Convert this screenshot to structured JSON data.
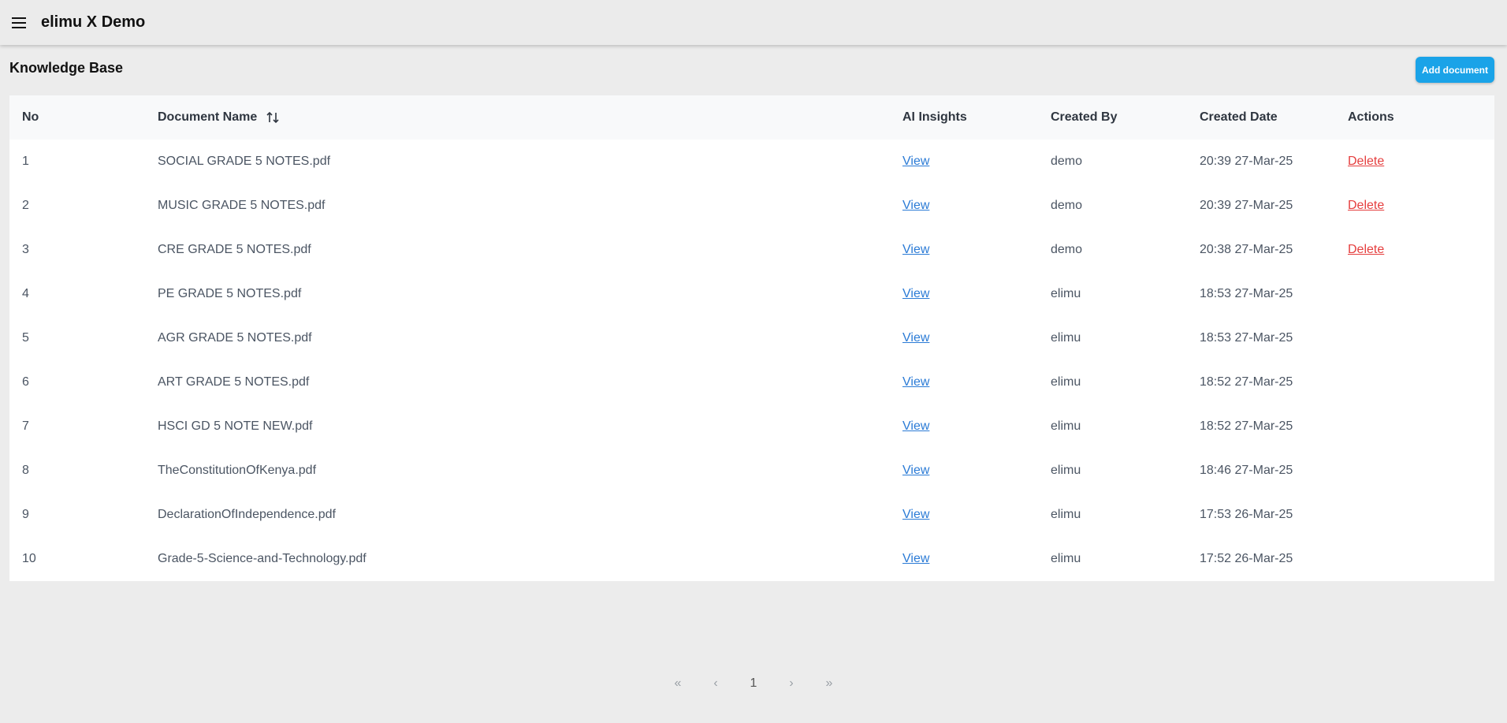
{
  "header": {
    "app_title": "elimu X Demo"
  },
  "page": {
    "title": "Knowledge Base",
    "add_button_label": "Add document"
  },
  "table": {
    "columns": [
      "No",
      "Document Name",
      "AI Insights",
      "Created By",
      "Created Date",
      "Actions"
    ],
    "rows": [
      {
        "no": "1",
        "name": "SOCIAL GRADE 5 NOTES.pdf",
        "ai": "View",
        "by": "demo",
        "date": "20:39 27-Mar-25",
        "action": "Delete"
      },
      {
        "no": "2",
        "name": "MUSIC GRADE 5 NOTES.pdf",
        "ai": "View",
        "by": "demo",
        "date": "20:39 27-Mar-25",
        "action": "Delete"
      },
      {
        "no": "3",
        "name": "CRE GRADE 5 NOTES.pdf",
        "ai": "View",
        "by": "demo",
        "date": "20:38 27-Mar-25",
        "action": "Delete"
      },
      {
        "no": "4",
        "name": "PE GRADE 5 NOTES.pdf",
        "ai": "View",
        "by": "elimu",
        "date": "18:53 27-Mar-25",
        "action": ""
      },
      {
        "no": "5",
        "name": "AGR GRADE 5 NOTES.pdf",
        "ai": "View",
        "by": "elimu",
        "date": "18:53 27-Mar-25",
        "action": ""
      },
      {
        "no": "6",
        "name": "ART GRADE 5 NOTES.pdf",
        "ai": "View",
        "by": "elimu",
        "date": "18:52 27-Mar-25",
        "action": ""
      },
      {
        "no": "7",
        "name": "HSCI GD 5 NOTE NEW.pdf",
        "ai": "View",
        "by": "elimu",
        "date": "18:52 27-Mar-25",
        "action": ""
      },
      {
        "no": "8",
        "name": "TheConstitutionOfKenya.pdf",
        "ai": "View",
        "by": "elimu",
        "date": "18:46 27-Mar-25",
        "action": ""
      },
      {
        "no": "9",
        "name": "DeclarationOfIndependence.pdf",
        "ai": "View",
        "by": "elimu",
        "date": "17:53 26-Mar-25",
        "action": ""
      },
      {
        "no": "10",
        "name": "Grade-5-Science-and-Technology.pdf",
        "ai": "View",
        "by": "elimu",
        "date": "17:52 26-Mar-25",
        "action": ""
      }
    ]
  },
  "pagination": {
    "first": "«",
    "prev": "‹",
    "current_page": "1",
    "next": "›",
    "last": "»"
  },
  "icons": {
    "menu": "menu-icon",
    "sort": "sort-icon"
  },
  "colors": {
    "accent": "#1aa3e8",
    "link": "#2b7bd6",
    "danger": "#e53e3e"
  }
}
